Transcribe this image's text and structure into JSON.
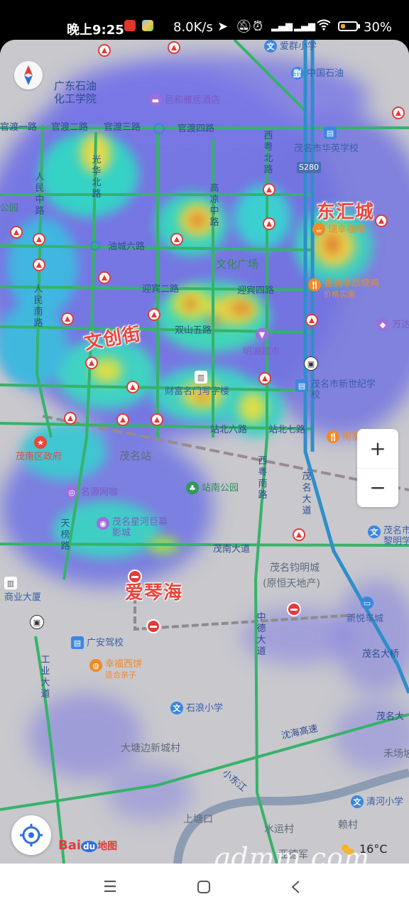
{
  "status": {
    "time": "晚上9:25",
    "speed": "8.0K/s",
    "battery": "30%",
    "battery_level": 0.3,
    "icons": [
      "location-arrow-icon",
      "mute-icon",
      "alarm-icon",
      "hd-signal-icon",
      "hd-signal-icon",
      "wifi-icon",
      "battery-icon"
    ]
  },
  "colors": {
    "road_green": "#35b36a",
    "road_blue": "#2e8fc9",
    "heat_low": "#5d6be6",
    "heat_mid": "#33d6c8",
    "heat_high": "#e6d24a",
    "heat_peak": "#e0732f",
    "accent_red": "#e8473d"
  },
  "map": {
    "big_labels": [
      "东汇城",
      "文创街",
      "爱琴海"
    ],
    "roads": {
      "guandu_1": "官渡一路",
      "guandu_2": "官渡二路",
      "guandu_3": "官渡三路",
      "guandu_4": "官渡四路",
      "xidu_north": "西粤北路",
      "guangzhu_north": "光华北路",
      "renmin_middle": "人民中路",
      "gaoliang_middle": "高凉中路",
      "youcheng_6": "油城六路",
      "yingbin_2": "迎宾二路",
      "yingbin_4": "迎宾四路",
      "shuangshan_5": "双山五路",
      "renmin_south": "人民南路",
      "zhanbei_6": "站北六路",
      "zhanbei_7": "站北七路",
      "xiyue_south": "西粤南路",
      "maoming_avenue": "茂名大道",
      "tianbo_road": "天榜路",
      "maonan_avenue": "茂南大道",
      "zhongde_avenue": "中德大道",
      "gongye_avenue": "工业大道",
      "shenhai_expressway": "沈海高速",
      "xiaodong_river": "小东江",
      "maoming_bridge": "茂名大桥",
      "maoming_da": "茂名大",
      "s280": "S280"
    },
    "areas": {
      "park": "公园",
      "culture_square": "文化广场",
      "maoming_station": "茂名站",
      "zhannan_park": "站南公园",
      "datangbian": "大塘边新城村",
      "shangtangkou": "上塘口",
      "shuiyunchun": "水运村",
      "baicun": "赖村",
      "hechangshe": "禾场坡",
      "ayuan": "亚德军"
    },
    "pois": {
      "guangdong_petro": "广东石油化工学院",
      "aigun_school": "爱群小学",
      "sinopec": "中国石油",
      "yihe_hotel": "邑和雅居酒店",
      "huaying_school": "茂名市华英学校",
      "ruixing_coffee": "瑞幸咖啡",
      "xiangmanting": "香满亭昂烧鸡",
      "xiangman_sub": "价格实惠",
      "wanda": "万达",
      "minghu_mall": "明湖超市",
      "century_school": "茂名市新世纪学校",
      "caifu": "财富名门写字楼",
      "nanyi": "南富",
      "maonan_gov": "茂南区政府",
      "mingyuan_netcafe": "名源网咖",
      "maoming_cinema": "茂名星河巨幕影城",
      "maoming_mingcheng": "茂名钧明城",
      "mingcheng_sub": "(原恒天地产)",
      "maoming_liming": "茂名市黎明学",
      "xinyue_city": "新悦车城",
      "business_mansion": "商业大厦",
      "guangan_driving": "广安驾校",
      "xingfu_xibing": "幸福西饼",
      "xingfu_sub": "适合亲子",
      "shilang_school": "石浪小学",
      "qinghe_school": "清河小学"
    }
  },
  "controls": {
    "zoom_in": "+",
    "zoom_out": "−",
    "brand": {
      "bai": "Bai",
      "du": "du",
      "tu": "地图"
    },
    "weather": "16°C",
    "watermark": "gdmm.com"
  }
}
